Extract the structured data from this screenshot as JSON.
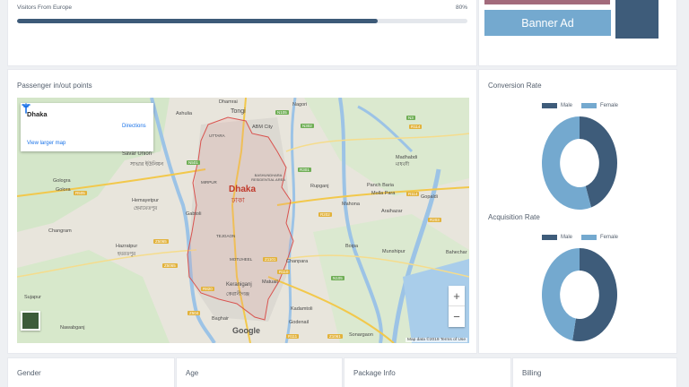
{
  "visitors": {
    "label": "Visitors From Europe",
    "percent_text": "80%",
    "percent": 0.8
  },
  "ads": {
    "banner_label": "Banner Ad"
  },
  "map_card": {
    "title": "Passenger in/out points",
    "place_name": "Dhaka",
    "directions_label": "Directions",
    "view_larger_label": "View larger map",
    "google_label": "Google",
    "footer": "Map data ©2019  Terms of Use",
    "zoom_in": "+",
    "zoom_out": "−",
    "labels": {
      "city": "Dhaka",
      "city_bn": "ঢাকা",
      "tongi": "Tongi",
      "dhamrai": "Dhamrai",
      "ashulia": "Ashulia",
      "savar": "Savar Union",
      "savar_bn": "সাভার ইউনিয়ন",
      "gologra": "Gologra",
      "golora": "Golora",
      "hemayetpur": "Hemayetpur",
      "hemayetpur_bn": "হেমায়েতপুর",
      "changram": "Changram",
      "hazratpur": "Hazratpur",
      "hazratpur_bn": "হযরতপুর",
      "sujapur": "Sujapur",
      "nawabganj": "Nawabganj",
      "bagha": "Baghair",
      "keraniganj": "Keraniganj",
      "keraniganj_bn": "কেরানীগঞ্জ",
      "matuail": "Matuail",
      "kadamtali": "Kadamtoli",
      "godenail": "Godenail",
      "sonargaon": "Sonargaon",
      "nagori": "Nagori",
      "madhabdi": "Madhabdi",
      "madhabdi_bn": "মাধবদী",
      "panchbaria": "Panch Baria",
      "mollapara": "Molla Para",
      "gopaldi": "Gopaldi",
      "rupganj": "Rupganj",
      "mahona": "Mahona",
      "araihazar": "Araihazar",
      "boipa": "Boipa",
      "munshipur": "Munshipur",
      "bahechar": "Bahechar",
      "chanpara": "Chanpara",
      "uttara": "UTTARA",
      "mirpur": "MIRPUR",
      "bashundhara": "BASHUNDHARA RESIDENTIAL AREA",
      "tejgaon": "TEJGAON",
      "motijheel": "MOTIJHEEL",
      "gabtoli": "Gabtoli",
      "abmcity": "ABM City"
    },
    "roads": [
      "N105",
      "N3",
      "N302",
      "R114",
      "R301",
      "N501",
      "R505",
      "R202",
      "R203",
      "R114",
      "Z5065",
      "Z504",
      "R820",
      "R110",
      "N105",
      "Z5065",
      "Z1101",
      "R111",
      "Z1061"
    ]
  },
  "conversion": {
    "title": "Conversion Rate",
    "legend": [
      {
        "name": "Male",
        "color": "#3e5c7a"
      },
      {
        "name": "Female",
        "color": "#74a9cf"
      }
    ],
    "values": {
      "male": 0.45,
      "female": 0.55
    }
  },
  "acquisition": {
    "title": "Acquisition Rate",
    "legend": [
      {
        "name": "Male",
        "color": "#3e5c7a"
      },
      {
        "name": "Female",
        "color": "#74a9cf"
      }
    ],
    "values": {
      "male": 0.53,
      "female": 0.47
    }
  },
  "bottom": {
    "gender": "Gender",
    "age": "Age",
    "package": "Package Info",
    "billing": "Billing"
  },
  "colors": {
    "male": "#3e5c7a",
    "female": "#74a9cf",
    "accent": "#3d5a78",
    "ad_strip": "#a36b7c"
  }
}
